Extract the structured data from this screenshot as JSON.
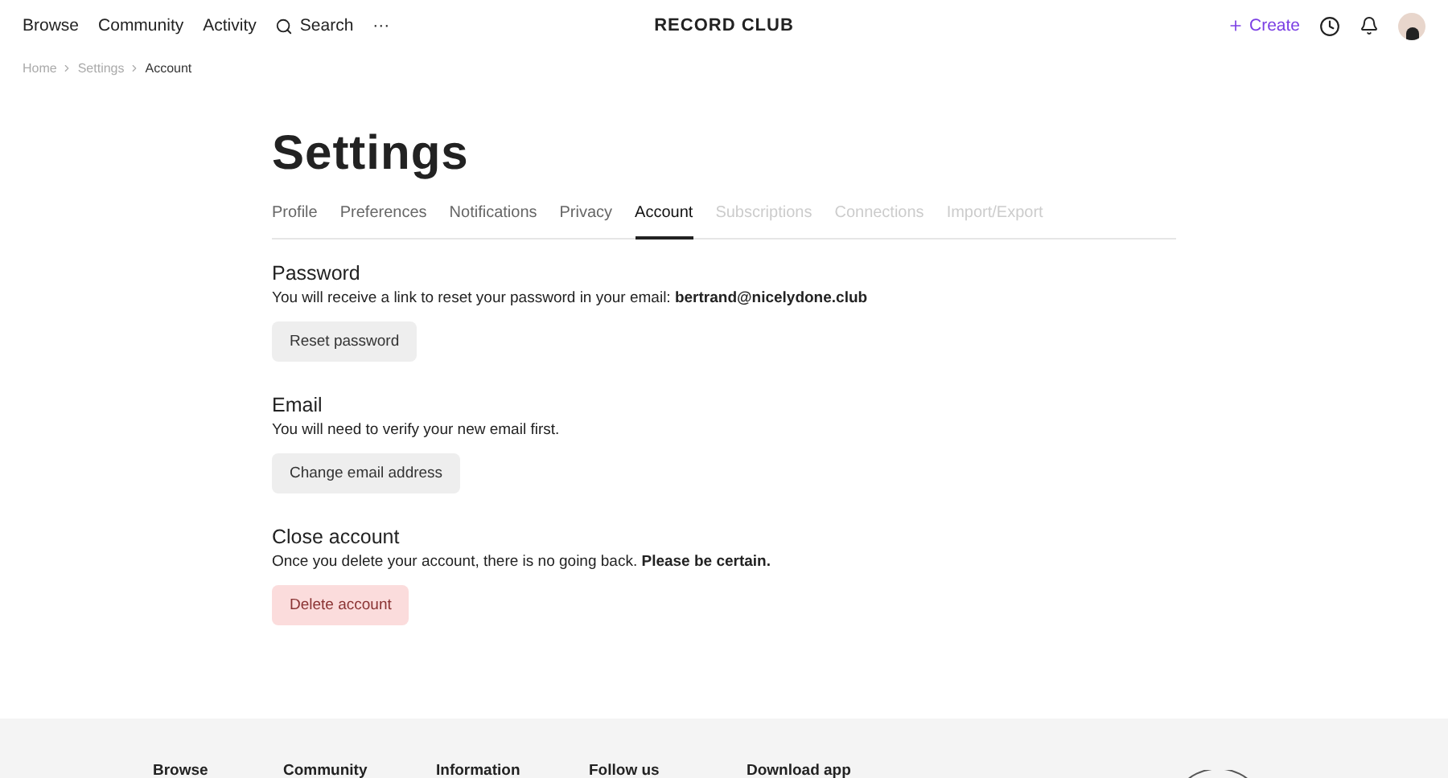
{
  "nav": {
    "links": [
      "Browse",
      "Community",
      "Activity"
    ],
    "search": "Search",
    "more": "···",
    "logo": "RECORD CLUB",
    "create": "Create"
  },
  "breadcrumb": [
    {
      "label": "Home",
      "current": false
    },
    {
      "label": "Settings",
      "current": false
    },
    {
      "label": "Account",
      "current": true
    }
  ],
  "title": "Settings",
  "tabs": [
    {
      "label": "Profile",
      "selected": false,
      "disabled": false
    },
    {
      "label": "Preferences",
      "selected": false,
      "disabled": false
    },
    {
      "label": "Notifications",
      "selected": false,
      "disabled": false
    },
    {
      "label": "Privacy",
      "selected": false,
      "disabled": false
    },
    {
      "label": "Account",
      "selected": true,
      "disabled": false
    },
    {
      "label": "Subscriptions",
      "selected": false,
      "disabled": true
    },
    {
      "label": "Connections",
      "selected": false,
      "disabled": true
    },
    {
      "label": "Import/Export",
      "selected": false,
      "disabled": true
    }
  ],
  "sections": [
    {
      "heading": "Password",
      "text": "You will receive a link to reset your password in your email: **bertrand@nicelydone.club**",
      "button": "Reset password",
      "kind": "normal"
    },
    {
      "heading": "Email",
      "text": "You will need to verify your new email first.",
      "button": "Change email address",
      "kind": "normal"
    },
    {
      "heading": "Close account",
      "text": "Once you delete your account, there is no going back. **Please be certain.**",
      "button": "Delete account",
      "kind": "danger"
    }
  ],
  "footer": {
    "columns": [
      "Browse",
      "Community",
      "Information",
      "Follow us",
      "Download app"
    ]
  }
}
